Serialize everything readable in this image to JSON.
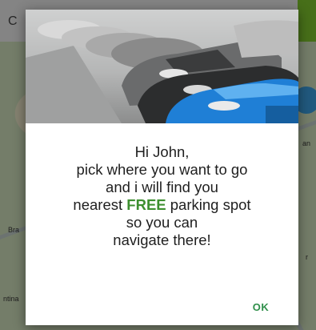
{
  "background": {
    "topbar_partial_text": "C",
    "map_labels": [
      "Bra",
      "ntina",
      "an",
      "r"
    ]
  },
  "dialog": {
    "image_icon": "parked-cars-photo",
    "message": {
      "line1": "Hi John,",
      "line2": "pick where you want to go",
      "line3": "and i will find you",
      "line4_before": "nearest",
      "line4_highlight": "FREE",
      "line4_after": "parking spot",
      "line5": "so you can",
      "line6": "navigate there!"
    },
    "ok_label": "OK"
  },
  "colors": {
    "accent_green": "#3d8f2f",
    "button_green": "#2f8f4a",
    "highlight_car_blue": "#1f7fd6"
  }
}
